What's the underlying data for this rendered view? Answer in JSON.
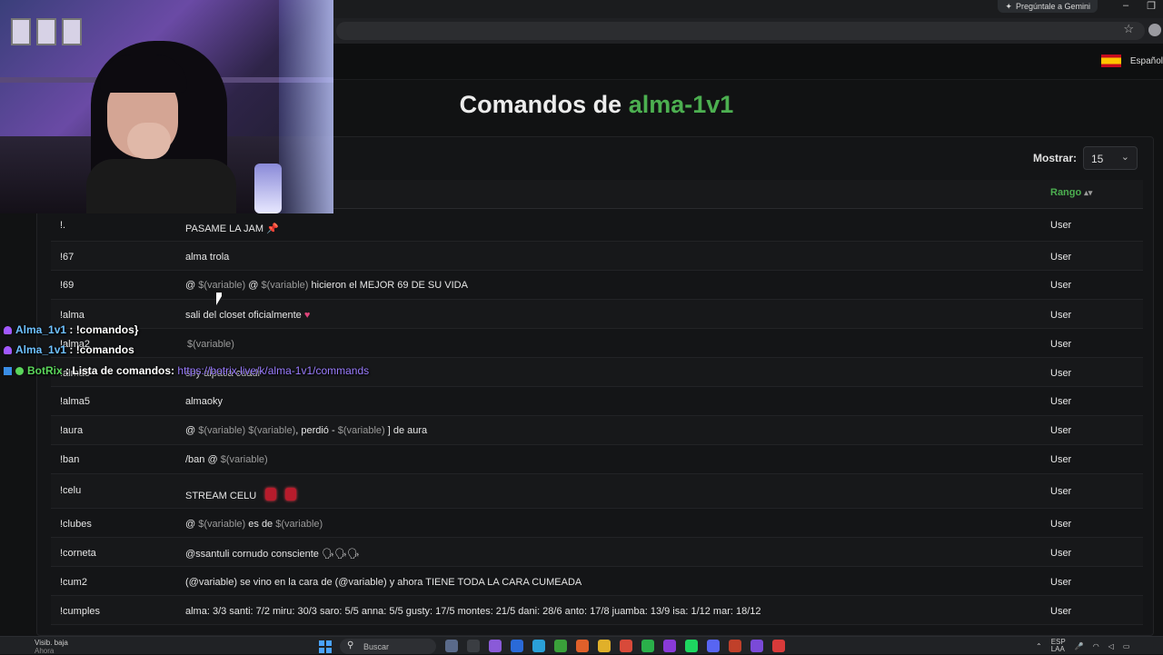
{
  "browser": {
    "gemini_label": "Pregúntale a Gemini",
    "win_min": "–",
    "win_restore": "❐"
  },
  "site": {
    "language": "Español"
  },
  "page": {
    "title_prefix": "Comandos de",
    "title_channel": "alma-1v1",
    "show_label": "Mostrar:",
    "show_value": "15",
    "rank_header": "Rango"
  },
  "rows": [
    {
      "cmd": "!.",
      "resp": "PASAME LA JAM",
      "rank": "User"
    },
    {
      "cmd": "!67",
      "resp": "alma trola",
      "rank": "User"
    },
    {
      "cmd": "!69",
      "rank": "User",
      "r_at1": "@",
      "r_var1": "$(variable)",
      "r_at2": "@",
      "r_var2": "$(variable)",
      "r_tail": "hicieron el MEJOR 69 DE SU VIDA"
    },
    {
      "cmd": "!alma",
      "resp": "sali del closet oficialmente",
      "rank": "User"
    },
    {
      "cmd": "!alma2",
      "resp": "$(variable)",
      "rank": "User"
    },
    {
      "cmd": "!alma3",
      "resp": "soy alpaca cuadr",
      "rank": "User"
    },
    {
      "cmd": "!alma5",
      "resp": "almaoky",
      "rank": "User"
    },
    {
      "cmd": "!aura",
      "rank": "User",
      "r_at1": "@",
      "r_var1": "$(variable)",
      "r_var2": "$(variable)",
      "r_mid": ", perdió -",
      "r_var3": "$(variable)",
      "r_tail": "] de aura"
    },
    {
      "cmd": "!ban",
      "rank": "User",
      "r_pre": "/ban @",
      "r_var1": "$(variable)"
    },
    {
      "cmd": "!celu",
      "resp": "STREAM CELU",
      "rank": "User"
    },
    {
      "cmd": "!clubes",
      "rank": "User",
      "r_at1": "@",
      "r_var1": "$(variable)",
      "r_mid": "es de",
      "r_var2": "$(variable)"
    },
    {
      "cmd": "!corneta",
      "resp": "@ssantuli cornudo consciente",
      "rank": "User"
    },
    {
      "cmd": "!cum2",
      "resp": "(@variable) se vino en la cara de (@variable) y ahora TIENE TODA LA CARA CUMEADA",
      "rank": "User"
    },
    {
      "cmd": "!cumples",
      "resp": "alma: 3/3 santi: 7/2 miru: 30/3 saro: 5/5 anna: 5/5 gusty: 17/5 montes: 21/5 dani: 28/6 anto: 17/8 juamba: 13/9 isa: 1/12 mar: 18/12",
      "rank": "User"
    }
  ],
  "chat": [
    {
      "user": "Alma_1v1",
      "sep": ":",
      "msg": "!comandos}"
    },
    {
      "user": "Alma_1v1",
      "sep": ":",
      "msg": "!comandos"
    },
    {
      "user": "BotRix",
      "sep": ":",
      "msg": "Lista de comandos:",
      "link": "https://botrix.live/k/alma-1v1/commands"
    }
  ],
  "taskbar": {
    "weather": "Visib. baja",
    "weather_sub": "Ahora",
    "search_placeholder": "Buscar",
    "lang": "ESP",
    "lang_sub": "LAA"
  },
  "colors": {
    "accent": "#4caf50",
    "link": "#9b7dff",
    "background": "#111213"
  }
}
